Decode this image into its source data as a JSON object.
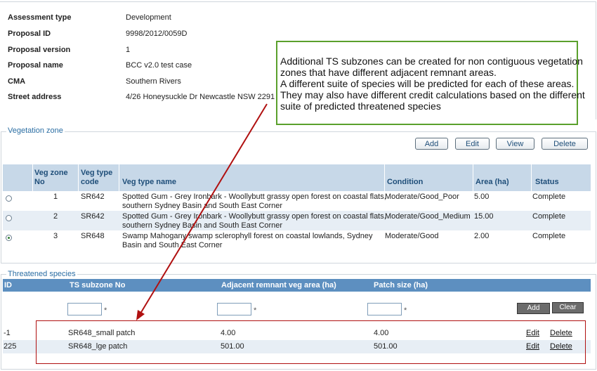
{
  "proposal": {
    "rows": [
      {
        "label": "Assessment type",
        "value": "Development"
      },
      {
        "label": "Proposal ID",
        "value": "9998/2012/0059D"
      },
      {
        "label": "Proposal version",
        "value": "1"
      },
      {
        "label": "Proposal name",
        "value": "BCC v2.0 test case"
      },
      {
        "label": "CMA",
        "value": "Southern Rivers"
      },
      {
        "label": "Street address",
        "value": "4/26 Honeysuckle Dr Newcastle NSW 2291"
      }
    ]
  },
  "callout": {
    "lines": [
      "Additional TS subzones can be created for non contiguous vegetation",
      "zones that have different adjacent remnant areas.",
      "A different suite of species will be predicted for each of these areas.",
      "They may also have different credit calculations based on the different",
      "suite of predicted threatened species"
    ],
    "border_color": "#5aa02c",
    "arrow_color": "#b01010"
  },
  "veg_zone": {
    "legend": "Vegetation zone",
    "buttons": {
      "add": "Add",
      "edit": "Edit",
      "view": "View",
      "delete": "Delete"
    },
    "headers": {
      "zone_no": "Veg zone No",
      "type_code": "Veg type code",
      "type_name": "Veg type name",
      "condition": "Condition",
      "area": "Area (ha)",
      "status": "Status"
    },
    "rows": [
      {
        "selected": false,
        "zone_no": "1",
        "type_code": "SR642",
        "name1": "Spotted Gum - Grey Ironbark - Woollybutt grassy open forest on coastal flats,",
        "name2": "southern Sydney Basin and South East Corner",
        "condition": "Moderate/Good_Poor",
        "area": "5.00",
        "status": "Complete"
      },
      {
        "selected": false,
        "zone_no": "2",
        "type_code": "SR642",
        "name1": "Spotted Gum - Grey Ironbark - Woollybutt grassy open forest on coastal flats,",
        "name2": "southern Sydney Basin and South East Corner",
        "condition": "Moderate/Good_Medium",
        "area": "15.00",
        "status": "Complete"
      },
      {
        "selected": true,
        "zone_no": "3",
        "type_code": "SR648",
        "name1": "Swamp Mahogany swamp sclerophyll forest on coastal lowlands, Sydney",
        "name2": "Basin and South East Corner",
        "condition": "Moderate/Good",
        "area": "2.00",
        "status": "Complete"
      }
    ]
  },
  "threatened": {
    "legend": "Threatened species",
    "headers": {
      "id": "ID",
      "subzone": "TS subzone No",
      "adjacent": "Adjacent remnant veg area (ha)",
      "patch": "Patch size (ha)"
    },
    "required_mark": "*",
    "add_label": "Add",
    "clear_label": "Clear",
    "rows": [
      {
        "id": "-1",
        "subzone": "SR648_small patch",
        "adjacent": "4.00",
        "patch": "4.00",
        "edit": "Edit",
        "delete": "Delete"
      },
      {
        "id": "225",
        "subzone": "SR648_lge patch",
        "adjacent": "501.00",
        "patch": "501.00",
        "edit": "Edit",
        "delete": "Delete"
      }
    ]
  }
}
